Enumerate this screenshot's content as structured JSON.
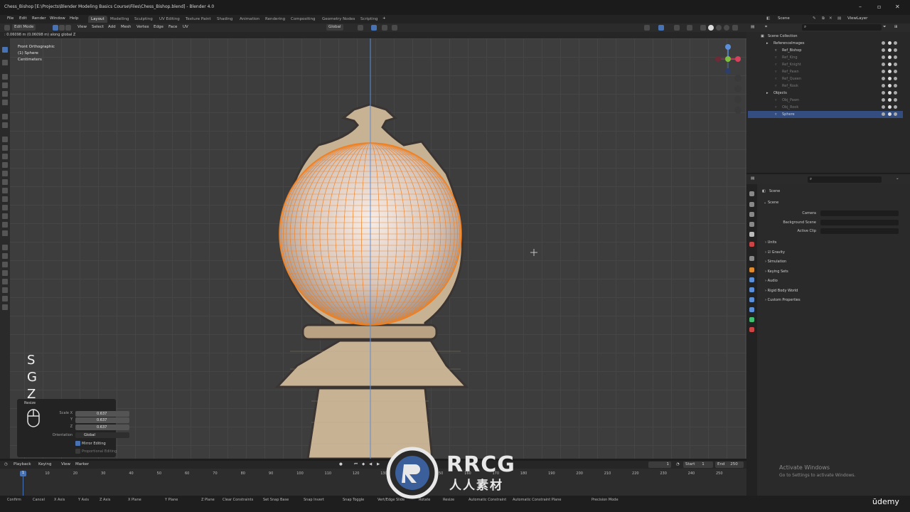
{
  "app": {
    "title": "Chess_Bishop [E:\\Projects\\Blender Modeling Basics Course\\Files\\Chess_Bishop.blend] - Blender 4.0"
  },
  "menu": {
    "items": [
      "File",
      "Edit",
      "Render",
      "Window",
      "Help"
    ],
    "workspaces": [
      "Layout",
      "Modelling",
      "Sculpting",
      "UV Editing",
      "Texture Paint",
      "Shading",
      "Animation",
      "Rendering",
      "Compositing",
      "Geometry Nodes",
      "Scripting"
    ],
    "active_workspace": "Layout",
    "scene_label": "Scene",
    "viewlayer_label": "ViewLayer"
  },
  "viewport_header": {
    "mode": "Edit Mode",
    "menus": [
      "View",
      "Select",
      "Add",
      "Mesh",
      "Vertex",
      "Edge",
      "Face",
      "UV"
    ],
    "orientation": "Global"
  },
  "status_line": ": 0.06098 m (0.06098 m) along global Z",
  "viewport": {
    "info": [
      "Front Orthographic",
      "(1) Sphere",
      "Centimeters"
    ],
    "keys": [
      "S",
      "G",
      "Z"
    ]
  },
  "resize_panel": {
    "title": "Resize",
    "scale_x_label": "Scale X",
    "scale_y_label": "Y",
    "scale_z_label": "Z",
    "scale_x": "0.637",
    "scale_y": "0.637",
    "scale_z": "0.637",
    "orientation_label": "Orientation",
    "orientation": "Global",
    "mirror_editing": "Mirror Editing",
    "proportional_editing": "Proportional Editing"
  },
  "timeline": {
    "menus": [
      "Playback",
      "Keying",
      "View",
      "Marker"
    ],
    "current_frame": "1",
    "start_label": "Start",
    "start": "1",
    "end_label": "End",
    "end": "250",
    "ticks": [
      "1",
      "10",
      "20",
      "30",
      "40",
      "50",
      "60",
      "70",
      "80",
      "90",
      "100",
      "110",
      "120",
      "130",
      "140",
      "150",
      "160",
      "170",
      "180",
      "190",
      "200",
      "210",
      "220",
      "230",
      "240",
      "250"
    ]
  },
  "statusbar": [
    "Confirm",
    "Cancel",
    "X Axis",
    "Y Axis",
    "Z Axis",
    "X Plane",
    "Y Plane",
    "Z Plane",
    "Clear Constraints",
    "Set Snap Base",
    "Snap Invert",
    "Snap Toggle",
    "Vert/Edge Slide",
    "Rotate",
    "Resize",
    "Automatic Constraint",
    "Automatic Constraint Plane",
    "Precision Mode"
  ],
  "outliner": {
    "rows": [
      {
        "name": "Scene Collection",
        "dim": false,
        "sel": false
      },
      {
        "name": "ReferenceImages",
        "dim": false,
        "sel": false
      },
      {
        "name": "Ref_Bishop",
        "dim": false,
        "sel": false
      },
      {
        "name": "Ref_King",
        "dim": true,
        "sel": false
      },
      {
        "name": "Ref_Knight",
        "dim": true,
        "sel": false
      },
      {
        "name": "Ref_Pawn",
        "dim": true,
        "sel": false
      },
      {
        "name": "Ref_Queen",
        "dim": true,
        "sel": false
      },
      {
        "name": "Ref_Rook",
        "dim": true,
        "sel": false
      },
      {
        "name": "Objects",
        "dim": false,
        "sel": false
      },
      {
        "name": "Obj_Pawn",
        "dim": true,
        "sel": false
      },
      {
        "name": "Obj_Rook",
        "dim": true,
        "sel": false
      },
      {
        "name": "Sphere",
        "dim": false,
        "sel": true
      }
    ]
  },
  "properties": {
    "breadcrumb": "Scene",
    "section": "Scene",
    "camera_label": "Camera",
    "background_scene_label": "Background Scene",
    "active_clip_label": "Active Clip",
    "panels": [
      "Units",
      "Gravity",
      "Simulation",
      "Keying Sets",
      "Audio",
      "Rigid Body World",
      "Custom Properties"
    ]
  },
  "os_watermark": {
    "line1": "Activate Windows",
    "line2": "Go to Settings to activate Windows."
  },
  "watermark": {
    "brand": "RRCG",
    "chinese": "人人素材",
    "udemy": "ūdemy"
  },
  "colors": {
    "accent": "#4772b3",
    "selection_orange": "#f08020",
    "bishop_beige": "#c8b294"
  }
}
